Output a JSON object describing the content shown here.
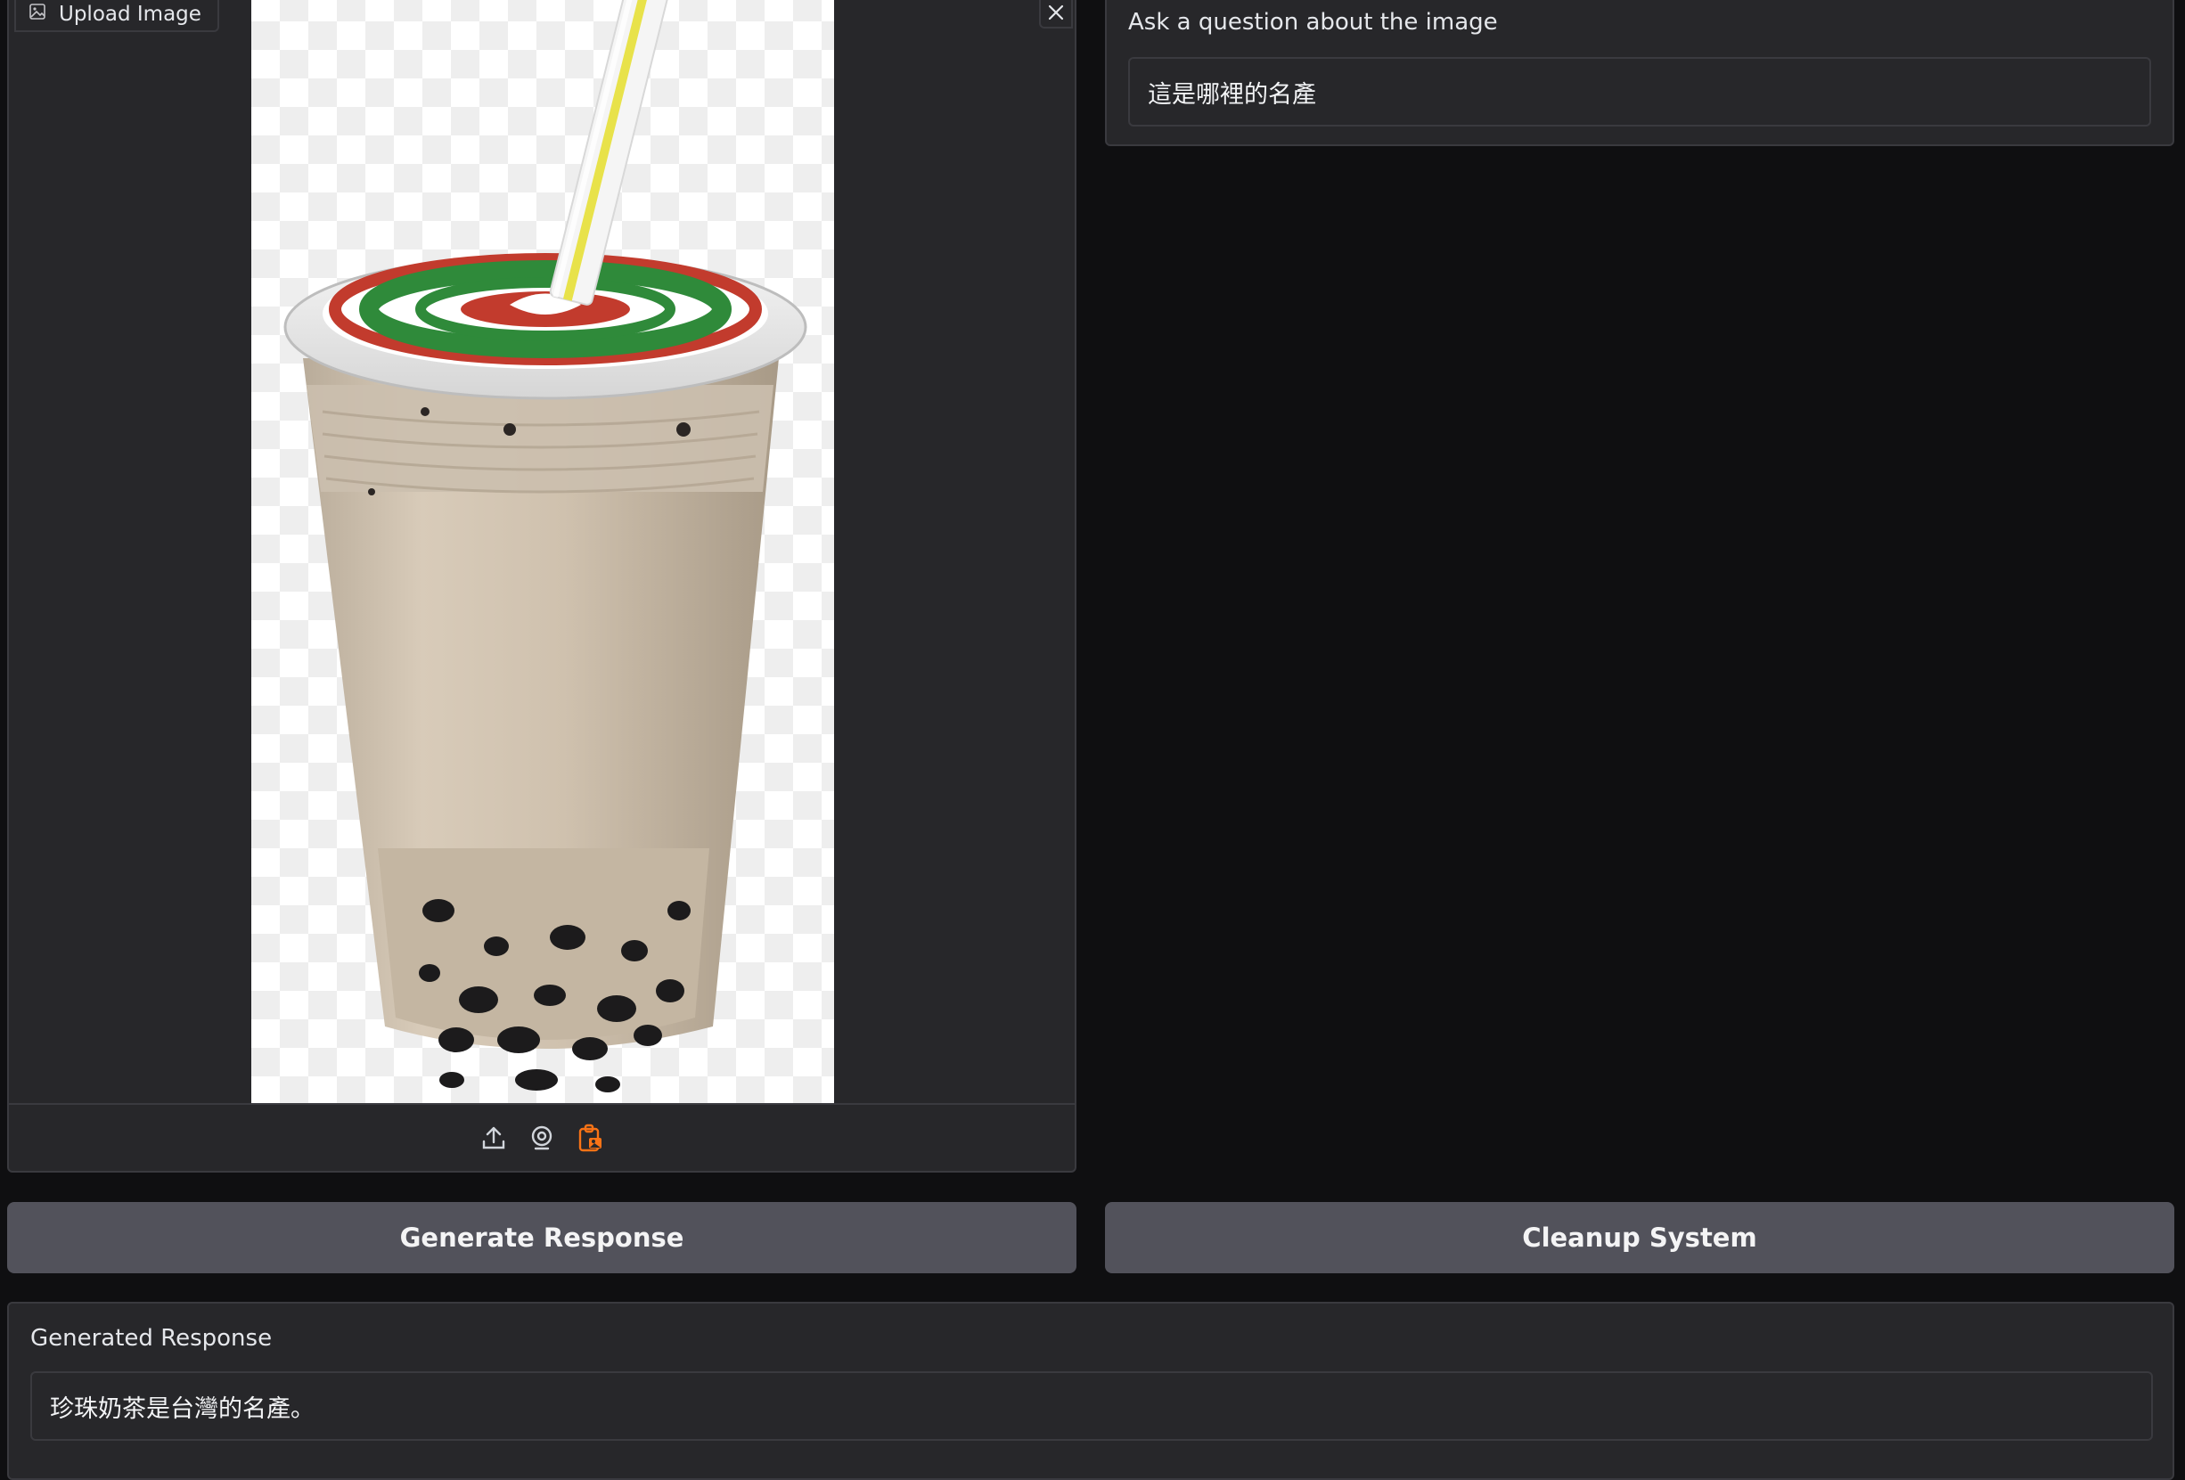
{
  "image_upload": {
    "label": "Upload Image",
    "image_alt": "bubble tea cup with straw and tapioca pearls",
    "toolbar": [
      "upload-icon",
      "webcam-icon",
      "clipboard-icon"
    ]
  },
  "question": {
    "label": "Ask a question about the image",
    "value": "這是哪裡的名產"
  },
  "buttons": {
    "generate": "Generate Response",
    "cleanup": "Cleanup System"
  },
  "response": {
    "label": "Generated Response",
    "value": "珍珠奶茶是台灣的名產。"
  },
  "colors": {
    "background": "#0f0f11",
    "panel": "#27272a",
    "border": "#3a3a3f",
    "button": "#52525b",
    "accent": "#f97316"
  }
}
